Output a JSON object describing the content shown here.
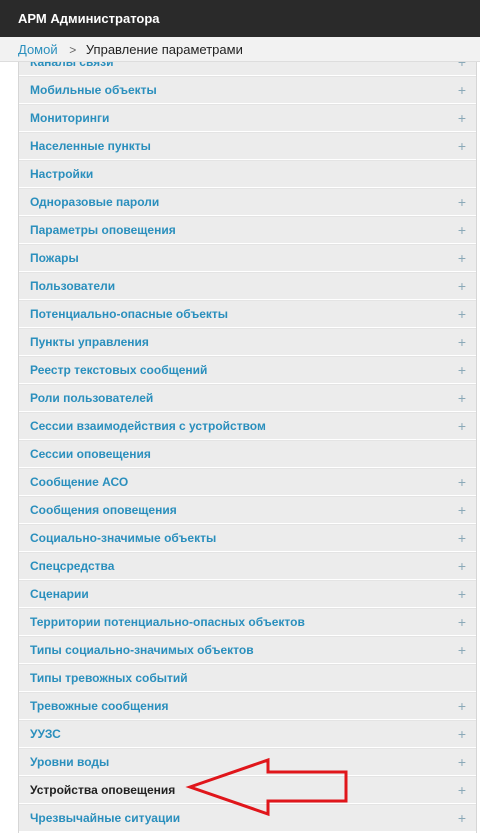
{
  "app": {
    "title": "АРМ Администратора"
  },
  "breadcrumb": {
    "home": "Домой",
    "separator": ">",
    "current": "Управление параметрами"
  },
  "list": {
    "items": [
      {
        "label": "Каналы связи",
        "expandable": true
      },
      {
        "label": "Мобильные объекты",
        "expandable": true
      },
      {
        "label": "Мониторинги",
        "expandable": true
      },
      {
        "label": "Населенные пункты",
        "expandable": true
      },
      {
        "label": "Настройки",
        "expandable": false
      },
      {
        "label": "Одноразовые пароли",
        "expandable": true
      },
      {
        "label": "Параметры оповещения",
        "expandable": true
      },
      {
        "label": "Пожары",
        "expandable": true
      },
      {
        "label": "Пользователи",
        "expandable": true
      },
      {
        "label": "Потенциально-опасные объекты",
        "expandable": true
      },
      {
        "label": "Пункты управления",
        "expandable": true
      },
      {
        "label": "Реестр текстовых сообщений",
        "expandable": true
      },
      {
        "label": "Роли пользователей",
        "expandable": true
      },
      {
        "label": "Сессии взаимодействия с устройством",
        "expandable": true
      },
      {
        "label": "Сессии оповещения",
        "expandable": false
      },
      {
        "label": "Сообщение АСО",
        "expandable": true
      },
      {
        "label": "Сообщения оповещения",
        "expandable": true
      },
      {
        "label": "Социально-значимые объекты",
        "expandable": true
      },
      {
        "label": "Спецсредства",
        "expandable": true
      },
      {
        "label": "Сценарии",
        "expandable": true
      },
      {
        "label": "Территории потенциально-опасных объектов",
        "expandable": true
      },
      {
        "label": "Типы социально-значимых объектов",
        "expandable": true
      },
      {
        "label": "Типы тревожных событий",
        "expandable": false
      },
      {
        "label": "Тревожные сообщения",
        "expandable": true
      },
      {
        "label": "УУЗС",
        "expandable": true
      },
      {
        "label": "Уровни воды",
        "expandable": true
      },
      {
        "label": "Устройства оповещения",
        "expandable": true,
        "active": true
      },
      {
        "label": "Чрезвычайные ситуации",
        "expandable": true
      }
    ],
    "plus_symbol": "+"
  },
  "annotation": {
    "arrow_color": "#e0161b",
    "target": "Устройства оповещения"
  }
}
